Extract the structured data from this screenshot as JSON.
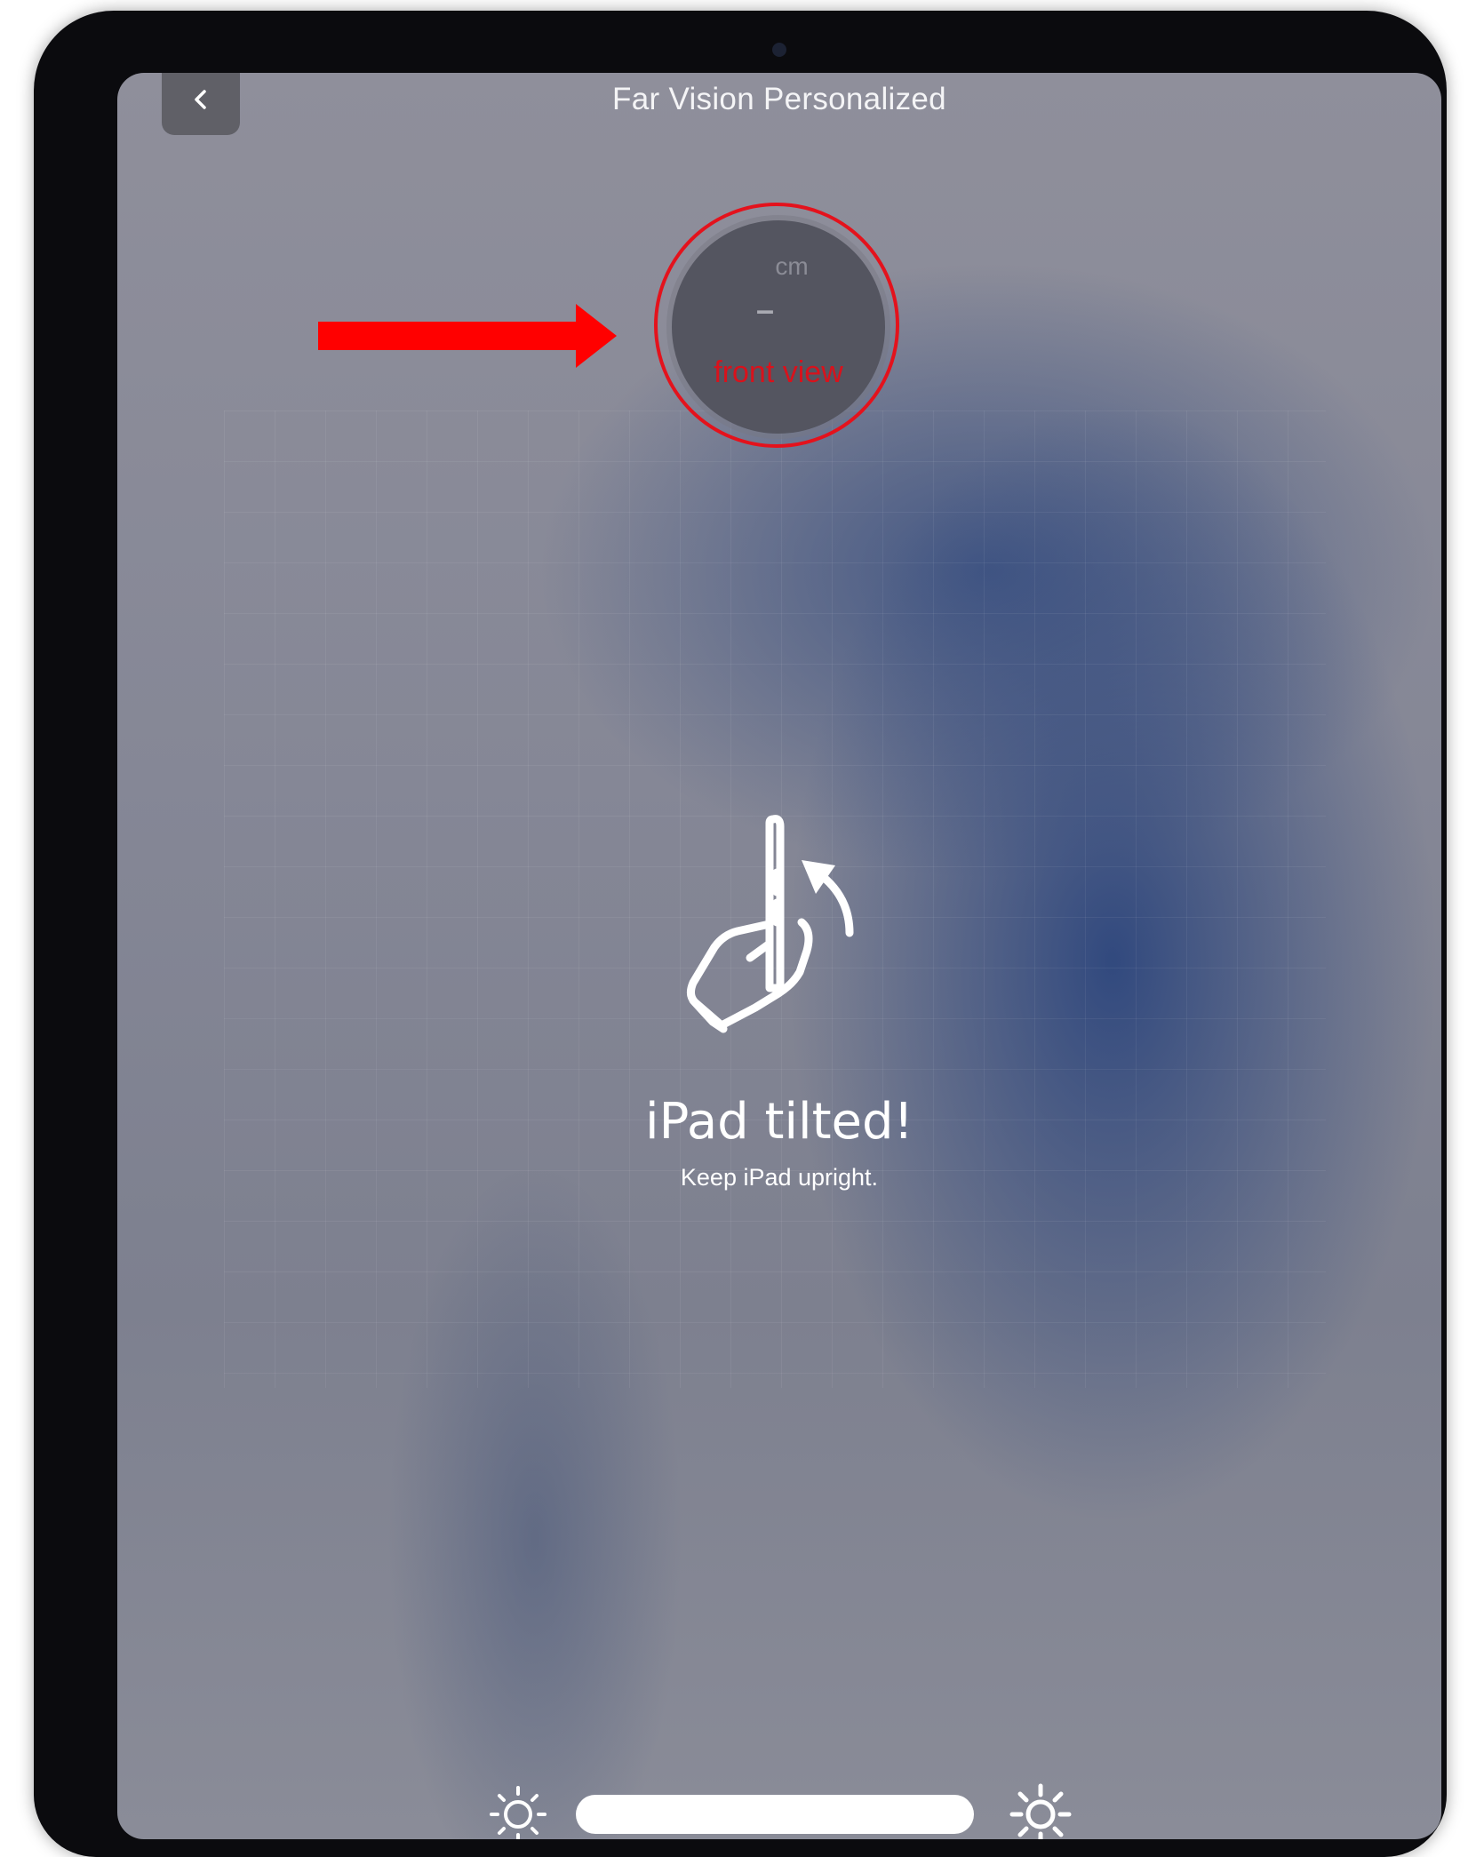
{
  "header": {
    "title": "Far Vision Personalized",
    "back_icon": "chevron-left-icon"
  },
  "gauge": {
    "unit": "cm",
    "value": "–",
    "label": "front view",
    "ring_color": "#e4121c"
  },
  "annotation": {
    "arrow_icon": "red-arrow-right-icon",
    "arrow_color": "#ff0000"
  },
  "message": {
    "icon": "hand-holding-ipad-tilt-icon",
    "title": "iPad tilted!",
    "subtitle": "Keep iPad upright."
  },
  "brightness": {
    "low_icon": "brightness-low-icon",
    "high_icon": "brightness-high-icon"
  }
}
